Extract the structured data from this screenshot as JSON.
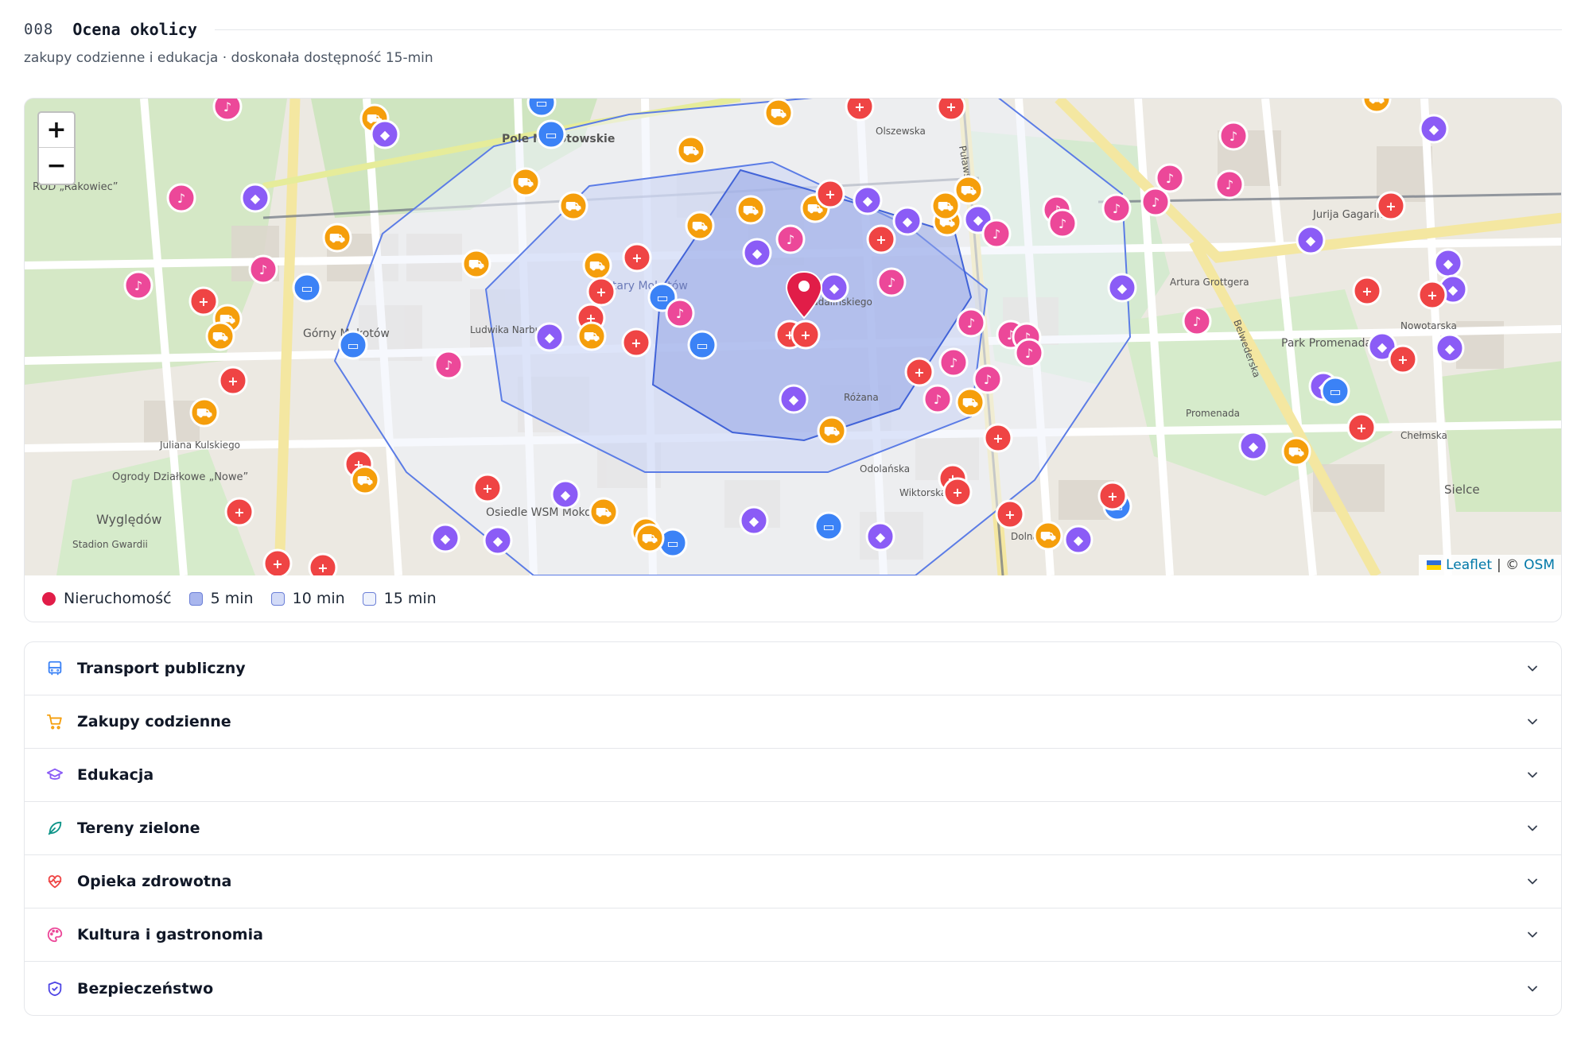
{
  "section": {
    "number": "008",
    "title": "Ocena okolicy",
    "subtitle": "zakupy codzienne i edukacja · doskonała dostępność 15-min"
  },
  "map": {
    "zoom_in": "+",
    "zoom_out": "−",
    "attribution": {
      "leaflet": "Leaflet",
      "sep": " | © ",
      "osm": "OSM"
    },
    "street_labels": [
      "Pole Mokotowskie",
      "Górny Mokotów",
      "Stary Mokotów",
      "Park Promenada",
      "Osiedle WSM Mokotów",
      "Wyględów",
      "Ogrody Działkowe „Nowe”",
      "ROD „Rakowiec”",
      "Olszewska",
      "Puławska",
      "Madalińskiego",
      "Różana",
      "Odolańska",
      "Wiktorska",
      "Belwederska",
      "Jurija Gagarina",
      "Chełmska",
      "Sielce",
      "Juliana Kulskiego",
      "Ludwika Narbutta",
      "Dolna",
      "Promenada",
      "Stadion Gwardii",
      "Artura Grottgera",
      "Nowotarska"
    ],
    "colors": {
      "transport": "#3b82f6",
      "shopping": "#f59e0b",
      "education": "#8b5cf6",
      "health": "#ef4444",
      "culture": "#ec4899",
      "office": "#6366f1",
      "property": "#e11d48"
    }
  },
  "legend": {
    "property": "Nieruchomość",
    "min5": "5 min",
    "min10": "10 min",
    "min15": "15 min"
  },
  "categories": [
    {
      "label": "Transport publiczny",
      "icon": "bus-icon",
      "color": "#3b82f6"
    },
    {
      "label": "Zakupy codzienne",
      "icon": "cart-icon",
      "color": "#f59e0b"
    },
    {
      "label": "Edukacja",
      "icon": "graduation-cap-icon",
      "color": "#8b5cf6"
    },
    {
      "label": "Tereny zielone",
      "icon": "leaf-icon",
      "color": "#0d9488"
    },
    {
      "label": "Opieka zdrowotna",
      "icon": "heart-pulse-icon",
      "color": "#ef4444"
    },
    {
      "label": "Kultura i gastronomia",
      "icon": "palette-icon",
      "color": "#ec4899"
    },
    {
      "label": "Bezpieczeństwo",
      "icon": "shield-check-icon",
      "color": "#4f46e5"
    }
  ]
}
